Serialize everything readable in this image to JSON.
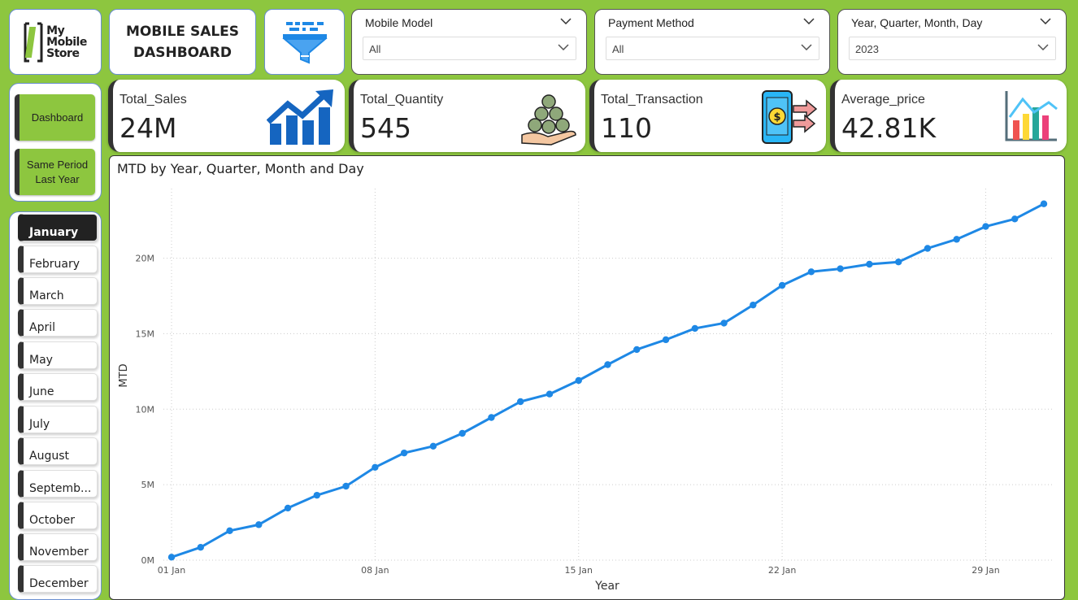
{
  "header": {
    "logo_text": "My\nMobile\nStore",
    "title": "MOBILE SALES\nDASHBOARD"
  },
  "slicers": [
    {
      "label": "Mobile Model",
      "value": "All"
    },
    {
      "label": "Payment Method",
      "value": "All"
    },
    {
      "label": "Year, Quarter, Month, Day",
      "value": "2023"
    }
  ],
  "nav": {
    "dashboard": "Dashboard",
    "same_period": "Same Period Last Year"
  },
  "months": {
    "selected": "January",
    "items": [
      "January",
      "February",
      "March",
      "April",
      "May",
      "June",
      "July",
      "August",
      "Septemb...",
      "October",
      "November",
      "December"
    ]
  },
  "kpis": [
    {
      "label": "Total_Sales",
      "value": "24M",
      "icon": "trend-up-icon"
    },
    {
      "label": "Total_Quantity",
      "value": "545",
      "icon": "coins-hand-icon"
    },
    {
      "label": "Total_Transaction",
      "value": "110",
      "icon": "phone-payment-icon"
    },
    {
      "label": "Average_price",
      "value": "42.81K",
      "icon": "bar-chart-icon"
    }
  ],
  "colors": {
    "background": "#8dc63f",
    "line": "#1e88e5",
    "dark": "#333333"
  },
  "chart_data": {
    "type": "line",
    "title": "MTD by Year, Quarter, Month and Day",
    "xlabel": "Year",
    "ylabel": "MTD",
    "x": [
      "01 Jan",
      "02 Jan",
      "03 Jan",
      "04 Jan",
      "05 Jan",
      "06 Jan",
      "07 Jan",
      "08 Jan",
      "09 Jan",
      "10 Jan",
      "11 Jan",
      "12 Jan",
      "13 Jan",
      "14 Jan",
      "15 Jan",
      "16 Jan",
      "17 Jan",
      "18 Jan",
      "19 Jan",
      "20 Jan",
      "21 Jan",
      "22 Jan",
      "23 Jan",
      "24 Jan",
      "25 Jan",
      "26 Jan",
      "27 Jan",
      "28 Jan",
      "29 Jan",
      "30 Jan",
      "31 Jan"
    ],
    "x_ticks": [
      "01 Jan",
      "08 Jan",
      "15 Jan",
      "22 Jan",
      "29 Jan"
    ],
    "y_ticks": [
      "0M",
      "5M",
      "10M",
      "15M",
      "20M"
    ],
    "ylim": [
      0,
      24.5
    ],
    "series": [
      {
        "values": [
          0.2,
          0.85,
          1.95,
          2.35,
          3.45,
          4.3,
          4.9,
          6.15,
          7.1,
          7.55,
          8.4,
          9.45,
          10.5,
          11.0,
          11.9,
          12.95,
          13.95,
          14.6,
          15.35,
          15.7,
          16.9,
          18.2,
          19.1,
          19.3,
          19.6,
          19.75,
          20.65,
          21.25,
          22.1,
          22.6,
          23.6
        ]
      }
    ],
    "y_unit": "M",
    "grid": true
  }
}
